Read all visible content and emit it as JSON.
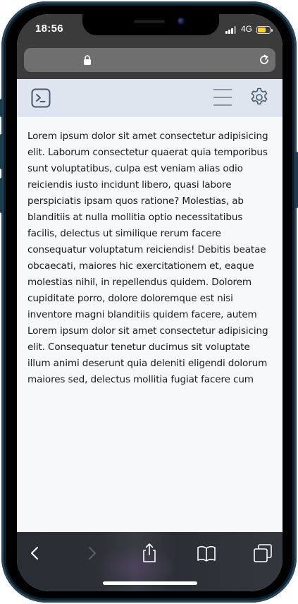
{
  "status_bar": {
    "time": "18:56",
    "network": "4G",
    "battery_color": "#f5d130"
  },
  "browser": {
    "url_icon": "lock-icon",
    "reload_icon": "reload-icon"
  },
  "header": {
    "left_icon": "terminal-icon",
    "menu_icon": "hamburger-menu-icon",
    "settings_icon": "gear-icon",
    "background": "#dfe5ee"
  },
  "main": {
    "paragraph": "Lorem ipsum dolor sit amet consectetur adipisicing elit. Laborum consectetur quaerat quia temporibus sunt voluptatibus, culpa est veniam alias odio reiciendis iusto incidunt libero, quasi labore perspiciatis ipsam quos ratione? Molestias, ab blanditiis at nulla mollitia optio necessitatibus facilis, delectus ut similique rerum facere consequatur voluptatum reiciendis! Debitis beatae obcaecati, maiores hic exercitationem et, eaque molestias nihil, in repellendus quidem. Dolorem cupiditate porro, dolore doloremque est nisi inventore magni blanditiis quidem facere, autem Lorem ipsum dolor sit amet consectetur adipisicing elit. Consequatur tenetur ducimus sit voluptate illum animi deserunt quia deleniti eligendi dolorum maiores sed, delectus mollitia fugiat facere cum"
  },
  "toolbar": {
    "buttons": [
      "back-icon",
      "forward-icon",
      "share-icon",
      "bookmarks-icon",
      "tabs-icon"
    ]
  }
}
